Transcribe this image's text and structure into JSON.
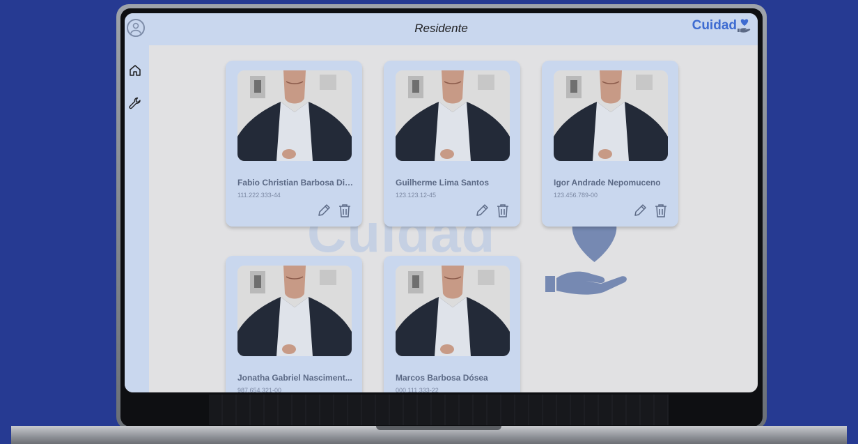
{
  "header": {
    "title": "Residente",
    "brand": "Cuidad"
  },
  "watermark": {
    "text": "Cuidad"
  },
  "sidebar": {
    "items": [
      {
        "icon": "home-icon"
      },
      {
        "icon": "wrench-icon"
      }
    ]
  },
  "residents": [
    {
      "name": "Fabio Christian Barbosa Diniz",
      "cpf": "111.222.333-44"
    },
    {
      "name": "Guilherme Lima Santos",
      "cpf": "123.123.12-45"
    },
    {
      "name": "Igor Andrade Nepomuceno",
      "cpf": "123.456.789-00"
    },
    {
      "name": "Jonatha Gabriel Nasciment...",
      "cpf": "987.654.321-00"
    },
    {
      "name": "Marcos Barbosa Dósea",
      "cpf": "000.111.333-22"
    }
  ],
  "colors": {
    "background": "#263a92",
    "panel": "#c9d7ee",
    "accent": "#3d6bd1",
    "text": "#5b6985"
  }
}
